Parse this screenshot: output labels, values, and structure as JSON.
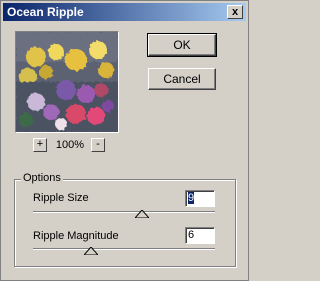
{
  "window": {
    "title": "Ocean Ripple",
    "close_glyph": "x"
  },
  "buttons": {
    "ok": "OK",
    "cancel": "Cancel"
  },
  "preview": {
    "zoom_in": "+",
    "zoom_out": "-",
    "zoom_level": "100%"
  },
  "options": {
    "title": "Options",
    "ripple_size": {
      "label": "Ripple Size",
      "value": "9",
      "slider_fraction": 0.6
    },
    "ripple_magnitude": {
      "label": "Ripple Magnitude",
      "value": "6",
      "slider_fraction": 0.32
    }
  },
  "colors": {
    "title_start": "#0a246a",
    "title_end": "#a6caf0",
    "face": "#d4d0c8",
    "selection": "#0a246a"
  }
}
